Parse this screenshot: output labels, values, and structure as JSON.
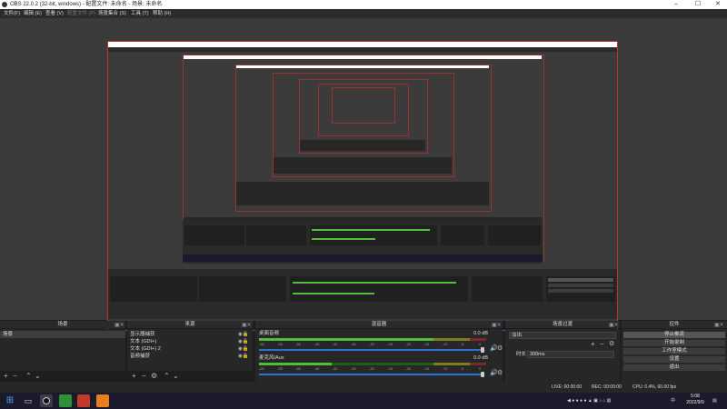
{
  "window": {
    "title": "OBS 22.0.2 (32-bit, windows) - 配置文件: 未命名 - 场景: 未命名",
    "minimize": "–",
    "maximize": "☐",
    "close": "✕"
  },
  "menu": [
    {
      "label": "文件(F)",
      "enabled": true
    },
    {
      "label": "编辑 (E)",
      "enabled": true
    },
    {
      "label": "查看 (V)",
      "enabled": true
    },
    {
      "label": "配置文件 (P)",
      "enabled": false
    },
    {
      "label": "场景集合 (S)",
      "enabled": true
    },
    {
      "label": "工具 (T)",
      "enabled": true
    },
    {
      "label": "帮助 (H)",
      "enabled": true
    }
  ],
  "docks": {
    "scenes": {
      "title": "场景",
      "items": [
        "场景"
      ]
    },
    "sources": {
      "title": "来源",
      "items": [
        "显示器捕获",
        "文本 (GDI+)",
        "文本 (GDI+) 2",
        "音频捕获"
      ]
    },
    "mixer": {
      "title": "混音器",
      "channels": [
        {
          "name": "桌面音频",
          "db": "0.0 dB",
          "level": 0.78
        },
        {
          "name": "麦克风/Aux",
          "db": "0.0 dB",
          "level": 0.32
        }
      ],
      "ticks": [
        "-60",
        "-55",
        "-50",
        "-45",
        "-40",
        "-35",
        "-30",
        "-25",
        "-20",
        "-15",
        "-10",
        "-5",
        "0"
      ]
    },
    "transitions": {
      "title": "场景过渡",
      "selected": "淡出",
      "duration_label": "时长",
      "duration_value": "300ms"
    },
    "controls": {
      "title": "控件",
      "buttons": [
        "停止推流",
        "开始录制",
        "工作室模式",
        "设置",
        "退出"
      ]
    }
  },
  "statusbar": {
    "live": "LIVE: 00:00:00",
    "rec": "REC: 00:00:00",
    "cpu": "CPU: 0.4%, 60.00 fps"
  },
  "taskbar": {
    "clock_time": "5:08",
    "clock_date": "2022/9/9",
    "tray_text": "中"
  },
  "colors": {
    "accent": "#2d6fd6",
    "meter_green": "#4fbf3a",
    "meter_yellow": "#c9c92d",
    "meter_red": "#c94040",
    "preview_border": "#bb3333"
  }
}
